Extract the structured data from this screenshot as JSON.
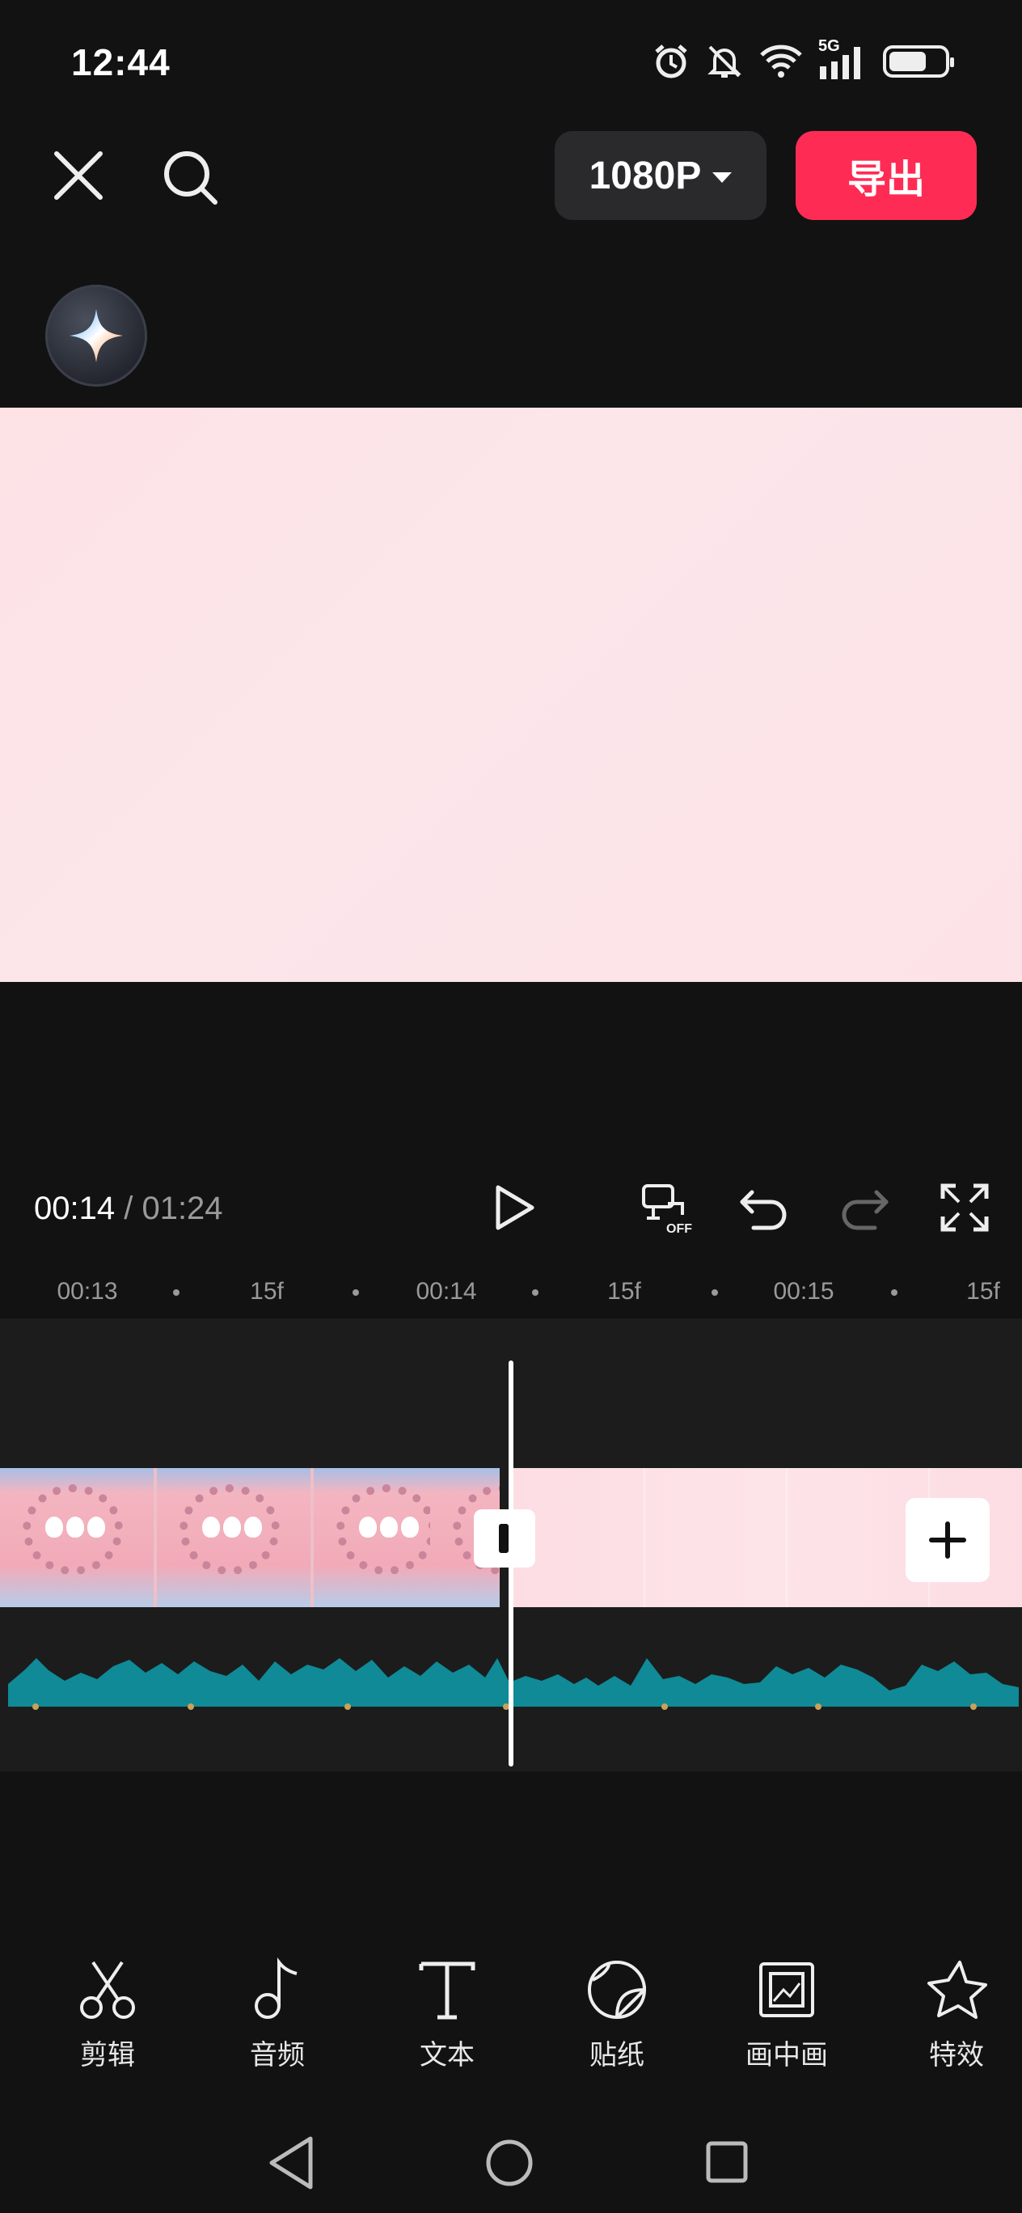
{
  "status_bar": {
    "time": "12:44",
    "network": "5G",
    "icons": [
      "alarm-icon",
      "mute-icon",
      "wifi-icon",
      "signal-icon",
      "battery-icon"
    ]
  },
  "toolbar": {
    "close_icon": "close-icon",
    "search_icon": "search-icon",
    "resolution_label": "1080P",
    "export_label": "导出",
    "export_color": "#fe2c55",
    "ai_icon": "sparkle-icon"
  },
  "playback": {
    "current_time": "00:14",
    "separator": " / ",
    "total_time": "01:24",
    "controls": [
      "play-icon",
      "auto-caption-off-icon",
      "undo-icon",
      "redo-icon",
      "fullscreen-icon"
    ]
  },
  "ruler": {
    "labels": [
      "00:13",
      "15f",
      "00:14",
      "15f",
      "00:15",
      "15f"
    ]
  },
  "tools": [
    {
      "label": "剪辑",
      "icon": "scissors-icon"
    },
    {
      "label": "音频",
      "icon": "music-note-icon"
    },
    {
      "label": "文本",
      "icon": "text-icon"
    },
    {
      "label": "贴纸",
      "icon": "sticker-icon"
    },
    {
      "label": "画中画",
      "icon": "picture-in-picture-icon"
    },
    {
      "label": "特效",
      "icon": "star-effect-icon"
    }
  ],
  "navigation": [
    "back-icon",
    "home-icon",
    "recents-icon"
  ],
  "colors": {
    "background": "#121212",
    "accent": "#fe2c55",
    "audio_wave": "#0f8a96"
  }
}
